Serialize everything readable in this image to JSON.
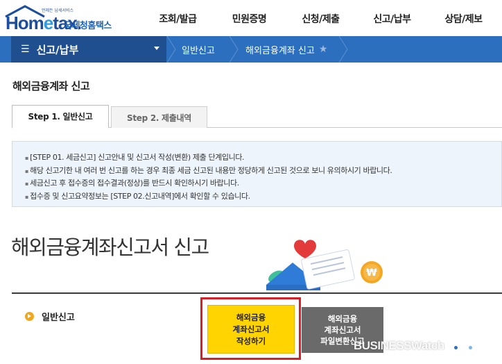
{
  "header": {
    "logo_tagline": "언제든 납세서비스",
    "logo_word_a": "Hom",
    "logo_word_e": "e",
    "logo_word_b": "tax.",
    "logo_kr": "국세청홈택스",
    "nav": [
      "조회/발급",
      "민원증명",
      "신청/제출",
      "신고/납부",
      "상담/제보"
    ]
  },
  "bluebar": {
    "current_menu": "신고/납부",
    "breadcrumb_1": "일반신고",
    "breadcrumb_2": "해외금융계좌 신고"
  },
  "page": {
    "title": "해외금융계좌 신고",
    "tabs": [
      "Step 1. 일반신고",
      "Step 2. 제출내역"
    ],
    "info_lines": [
      "[STEP 01. 세금신고] 신고안내 및 신고서 작성(변환) 제출 단계입니다.",
      "해당 신고기한 내 여러 번 신고를 하는 경우 최종 세금 신고된 내용만 정당하게 신고된 것으로 보니 유의하시기 바랍니다.",
      "세금신고 후 접수증의 접수결과(정상)를 반드시 확인하시기 바랍니다.",
      "접수증 및 신고요약정보는 [STEP 02.신고내역]에서 확인할 수 있습니다."
    ],
    "banner_title": "해외금융계좌신고서 신고",
    "section_label": "일반신고",
    "btn_write": "해외금융\n계좌신고서\n작성하기",
    "btn_convert": "해외금융\n계좌신고서\n파일변환신고"
  },
  "watermark": "BUSINESSWatch",
  "colors": {
    "brand_blue": "#2d6fbf",
    "highlight_red": "#d71f26",
    "button_yellow": "#ffd400"
  }
}
